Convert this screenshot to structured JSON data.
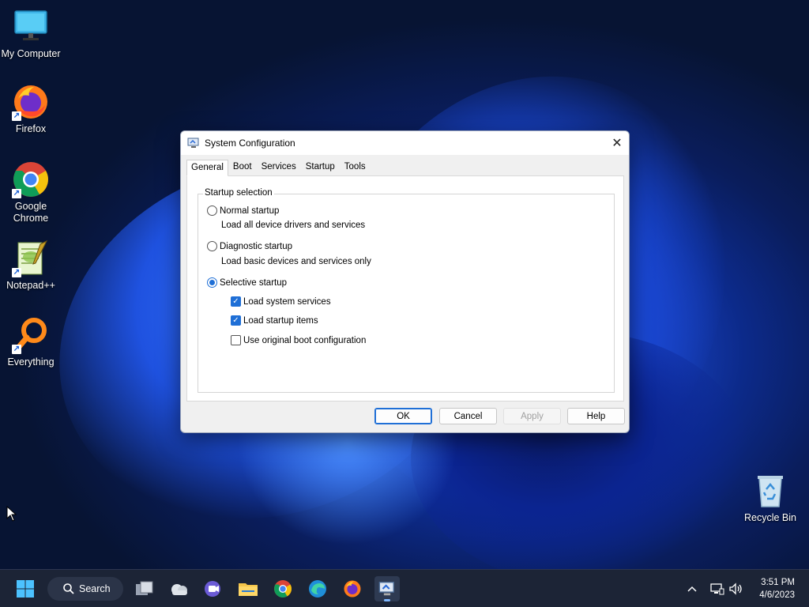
{
  "desktop": {
    "icons": [
      {
        "label": "My Computer"
      },
      {
        "label": "Firefox"
      },
      {
        "label": "Google Chrome"
      },
      {
        "label": "Notepad++"
      },
      {
        "label": "Everything"
      },
      {
        "label": "Recycle Bin"
      }
    ]
  },
  "dialog": {
    "title": "System Configuration",
    "close_glyph": "✕",
    "tabs": [
      "General",
      "Boot",
      "Services",
      "Startup",
      "Tools"
    ],
    "active_tab": "General",
    "group_label": "Startup selection",
    "options": [
      {
        "label": "Normal startup",
        "desc": "Load all device drivers and services",
        "selected": false
      },
      {
        "label": "Diagnostic startup",
        "desc": "Load basic devices and services only",
        "selected": false
      },
      {
        "label": "Selective startup",
        "selected": true
      }
    ],
    "checkboxes": [
      {
        "label": "Load system services",
        "checked": true
      },
      {
        "label": "Load startup items",
        "checked": true
      },
      {
        "label": "Use original boot configuration",
        "checked": false
      }
    ],
    "buttons": {
      "ok": "OK",
      "cancel": "Cancel",
      "apply": "Apply",
      "help": "Help"
    }
  },
  "taskbar": {
    "search_label": "Search",
    "clock_time": "3:51 PM",
    "clock_date": "4/6/2023"
  },
  "colors": {
    "accent": "#1f6fd6",
    "taskbar": "#1c2436"
  }
}
